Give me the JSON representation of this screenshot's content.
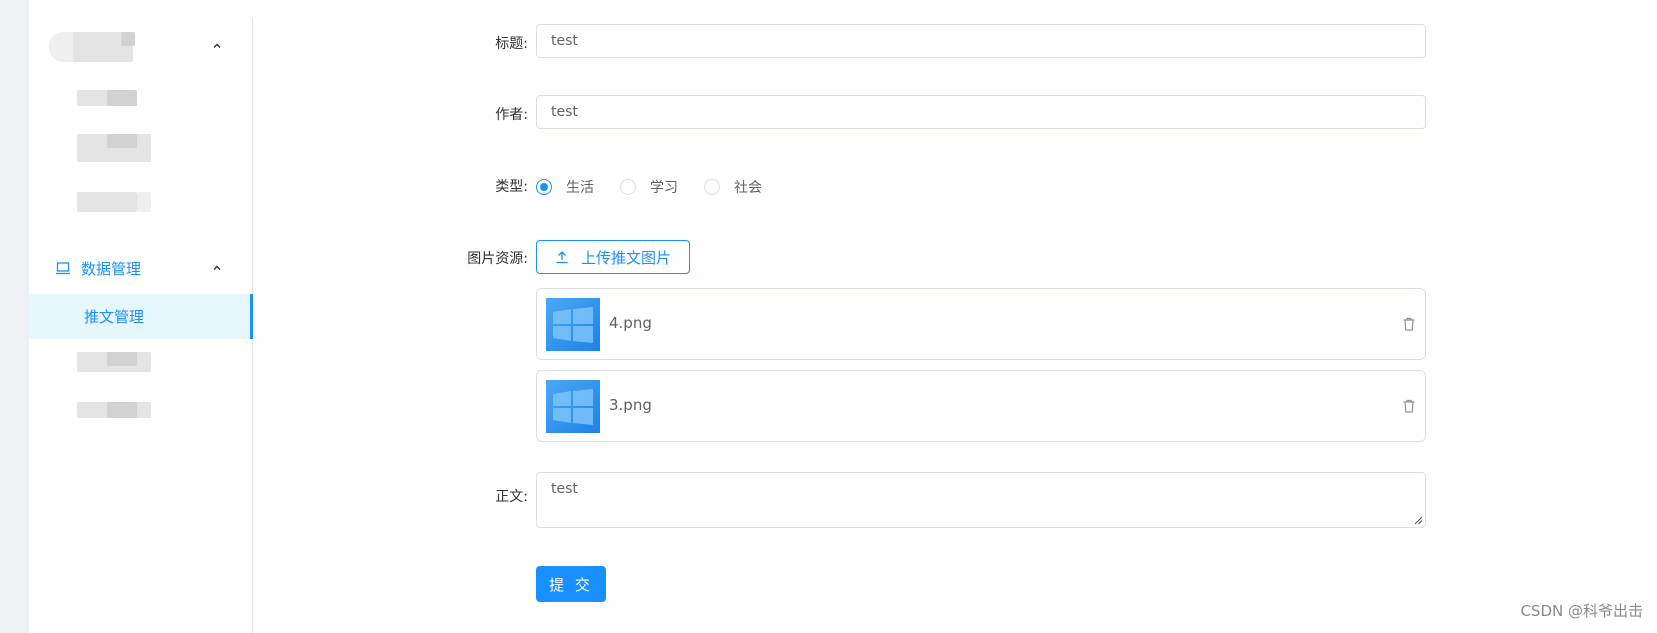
{
  "sidebar": {
    "group_label": "数据管理",
    "active_item": "推文管理",
    "accent_color": "#1890ff"
  },
  "form": {
    "title_label": "标题:",
    "title_value": "test",
    "author_label": "作者:",
    "author_value": "test",
    "type_label": "类型:",
    "type_options": [
      {
        "label": "生活",
        "checked": true
      },
      {
        "label": "学习",
        "checked": false
      },
      {
        "label": "社会",
        "checked": false
      }
    ],
    "image_label": "图片资源:",
    "upload_button": "上传推文图片",
    "files": [
      {
        "name": "4.png"
      },
      {
        "name": "3.png"
      }
    ],
    "body_label": "正文:",
    "body_value": "test",
    "submit_label": "提 交"
  },
  "watermark": "CSDN @科爷出击"
}
